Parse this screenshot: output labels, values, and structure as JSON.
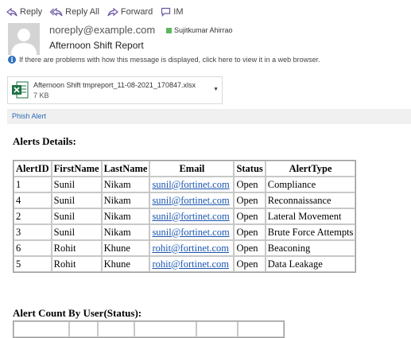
{
  "toolbar": {
    "reply": "Reply",
    "reply_all": "Reply All",
    "forward": "Forward",
    "im": "IM"
  },
  "message": {
    "from": "noreply@example.com",
    "recipient": "Sujitkumar Ahirrao",
    "subject": "Afternoon Shift Report",
    "info_text": "If there are problems with how this message is displayed, click here to view it in a web browser."
  },
  "attachment": {
    "name": "Afternoon Shift tmpreport_11-08-2021_170847.xlsx",
    "size": "7 KB"
  },
  "phish_alert": "Phish Alert",
  "alerts": {
    "heading": "Alerts Details:",
    "columns": [
      "AlertID",
      "FirstName",
      "LastName",
      "Email",
      "Status",
      "AlertType"
    ],
    "rows": [
      [
        "1",
        "Sunil",
        "Nikam",
        "sunil@fortinet.com",
        "Open",
        "Compliance"
      ],
      [
        "4",
        "Sunil",
        "Nikam",
        "sunil@fortinet.com",
        "Open",
        "Reconnaissance"
      ],
      [
        "2",
        "Sunil",
        "Nikam",
        "sunil@fortinet.com",
        "Open",
        "Lateral Movement"
      ],
      [
        "3",
        "Sunil",
        "Nikam",
        "sunil@fortinet.com",
        "Open",
        "Brute Force Attempts"
      ],
      [
        "6",
        "Rohit",
        "Khune",
        "rohit@fortinet.com",
        "Open",
        "Beaconing"
      ],
      [
        "5",
        "Rohit",
        "Khune",
        "rohit@fortinet.com",
        "Open",
        "Data Leakage"
      ]
    ]
  },
  "alert_count": {
    "heading": "Alert Count By User(Status):"
  },
  "colors": {
    "link": "#1a55b0",
    "presence": "#5cb85c",
    "excel": "#1e7145",
    "phish_bar": "#f0f0f0"
  }
}
